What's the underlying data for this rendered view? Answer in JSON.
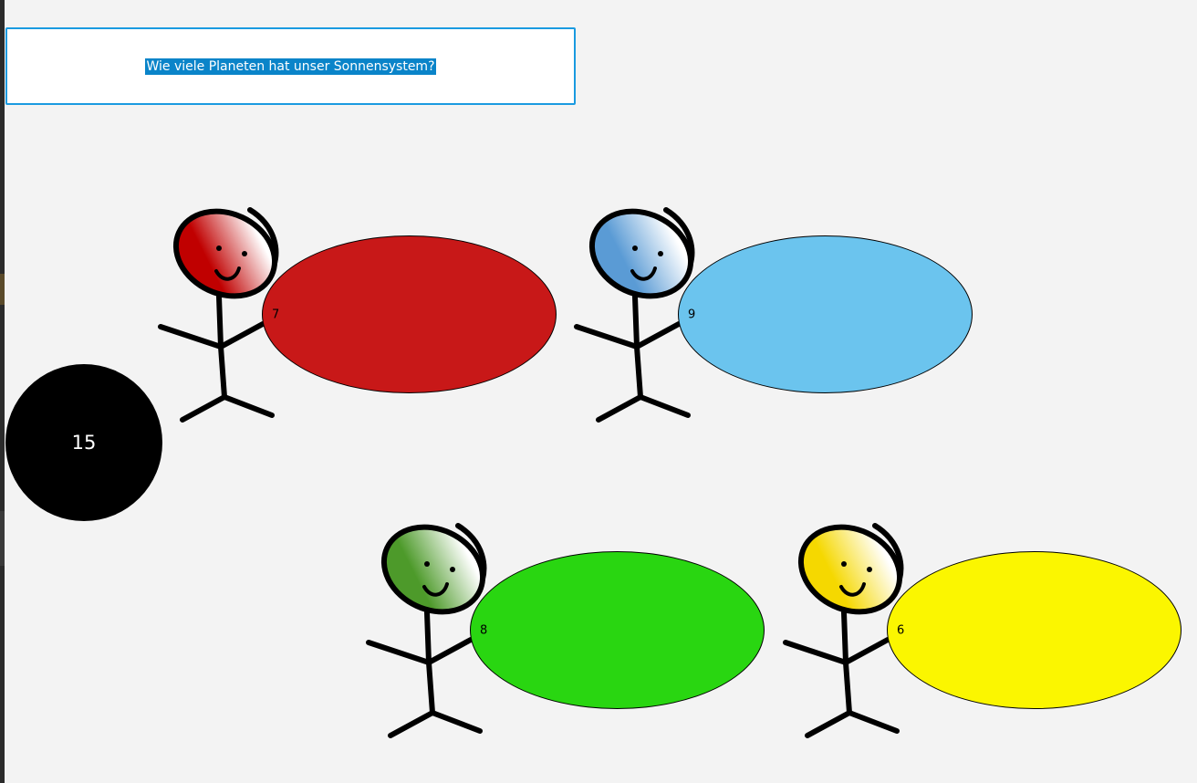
{
  "question": "Wie viele Planeten hat unser Sonnensystem?",
  "timer": "15",
  "colors": {
    "question_border": "#1a9ae0",
    "question_highlight": "#0a84c9",
    "background": "#f3f3f3",
    "timer_bg": "#000000"
  },
  "players": [
    {
      "id": "red",
      "answer": "7",
      "answer_color": "#c81818",
      "head_color": "#c00000"
    },
    {
      "id": "blue",
      "answer": "9",
      "answer_color": "#6bc4ee",
      "head_color": "#5a9bd5"
    },
    {
      "id": "green",
      "answer": "8",
      "answer_color": "#29d611",
      "head_color": "#4d9a2a"
    },
    {
      "id": "yellow",
      "answer": "6",
      "answer_color": "#fbf600",
      "head_color": "#f5d800"
    }
  ]
}
